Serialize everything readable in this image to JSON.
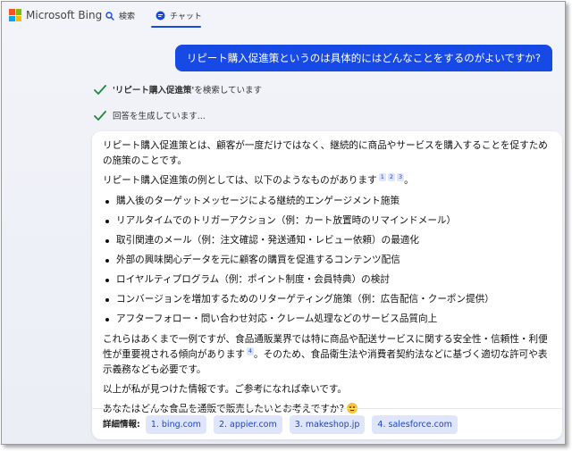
{
  "header": {
    "brand": "Microsoft Bing",
    "search_tab": "検索",
    "chat_tab": "チャット",
    "logo_colors": [
      "#f35325",
      "#81bc06",
      "#05a6f0",
      "#ffba08"
    ]
  },
  "user_message": "リピート購入促進策というのは具体的にはどんなことをするのがよいですか?",
  "progress": {
    "searching_quoted": "'リピート購入促進策'",
    "searching_suffix": " を検索しています",
    "generating": "回答を生成しています..."
  },
  "answer": {
    "intro": "リピート購入促進策とは、顧客が一度だけではなく、継続的に商品やサービスを購入することを促すための施策のことです。",
    "examples_lead": "リピート購入促進策の例としては、以下のようなものがあります",
    "examples_lead_cites": [
      "1",
      "2",
      "3"
    ],
    "examples_lead_end": "。",
    "items": [
      "購入後のターゲットメッセージによる継続的エンゲージメント施策",
      "リアルタイムでのトリガーアクション（例：カート放置時のリマインドメール）",
      "取引関連のメール（例：注文確認・発送通知・レビュー依頼）の最適化",
      "外部の興味関心データを元に顧客の購買を促進するコンテンツ配信",
      "ロイヤルティプログラム（例：ポイント制度・会員特典）の検討",
      "コンバージョンを増加するためのリターゲティング施策（例：広告配信・クーポン提供）",
      "アフターフォロー・問い合わせ対応・クレーム処理などのサービス品質向上"
    ],
    "note_before_cite": "これらはあくまで一例ですが、食品通販業界では特に商品や配送サービスに関する安全性・信頼性・利便性が重要視される傾向があります",
    "note_cite": "4",
    "note_after_cite": "。そのため、食品衛生法や消費者契約法などに基づく適切な許可や表示義務なども必要です。",
    "closing": "以上が私が見つけた情報です。ご参考になれば幸いです。",
    "question": "あなたはどんな食品を通販で販売したいとお考えですか?",
    "learn_more_label": "詳細情報:",
    "sources": [
      "1. bing.com",
      "2. appier.com",
      "3. makeshop.jp",
      "4. salesforce.com"
    ]
  }
}
